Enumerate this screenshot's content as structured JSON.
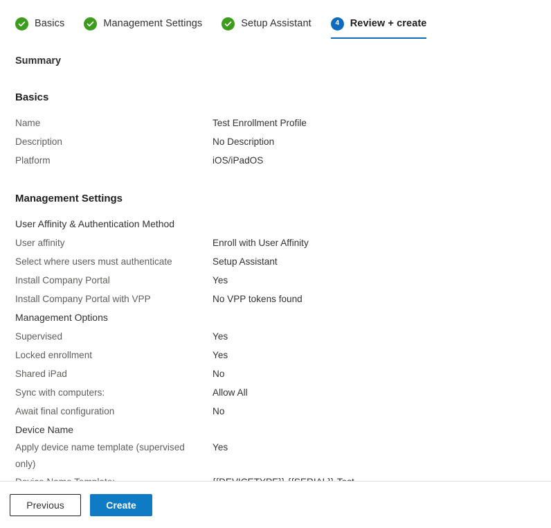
{
  "wizard": {
    "tabs": [
      {
        "label": "Basics",
        "state": "done",
        "badge": "check-icon"
      },
      {
        "label": "Management Settings",
        "state": "done",
        "badge": "check-icon"
      },
      {
        "label": "Setup Assistant",
        "state": "done",
        "badge": "check-icon"
      },
      {
        "label": "Review + create",
        "state": "current",
        "badge": "4"
      }
    ]
  },
  "summary": {
    "title": "Summary"
  },
  "sections": [
    {
      "title": "Basics",
      "rows": [
        {
          "label": "Name",
          "value": "Test Enrollment Profile",
          "type": "item"
        },
        {
          "label": "Description",
          "value": "No Description",
          "type": "item"
        },
        {
          "label": "Platform",
          "value": "iOS/iPadOS",
          "type": "item"
        }
      ]
    },
    {
      "title": "Management Settings",
      "rows": [
        {
          "label": "User Affinity & Authentication Method",
          "value": "",
          "type": "subhead"
        },
        {
          "label": "User affinity",
          "value": "Enroll with User Affinity",
          "type": "item"
        },
        {
          "label": "Select where users must authenticate",
          "value": "Setup Assistant",
          "type": "item"
        },
        {
          "label": "Install Company Portal",
          "value": "Yes",
          "type": "item"
        },
        {
          "label": "Install Company Portal with VPP",
          "value": "No VPP tokens found",
          "type": "item"
        },
        {
          "label": "Management Options",
          "value": "",
          "type": "subhead"
        },
        {
          "label": "Supervised",
          "value": "Yes",
          "type": "item"
        },
        {
          "label": "Locked enrollment",
          "value": "Yes",
          "type": "item"
        },
        {
          "label": "Shared iPad",
          "value": "No",
          "type": "item"
        },
        {
          "label": "Sync with computers:",
          "value": "Allow All",
          "type": "item"
        },
        {
          "label": "Await final configuration",
          "value": "No",
          "type": "item"
        },
        {
          "label": "Device Name",
          "value": "",
          "type": "subhead"
        },
        {
          "label": "Apply device name template (supervised only)",
          "value": "Yes",
          "type": "item-wrap"
        },
        {
          "label": "Device Name Template:",
          "value": "{{DEVICETYPE}}-{{SERIAL}}-Test",
          "type": "item"
        }
      ]
    }
  ],
  "footer": {
    "previous_label": "Previous",
    "create_label": "Create"
  },
  "colors": {
    "accent": "#0f6cbd",
    "primary_button": "#0f7bc4",
    "success": "#3d9c1c",
    "label_text": "#605e5c",
    "value_text": "#323130"
  }
}
